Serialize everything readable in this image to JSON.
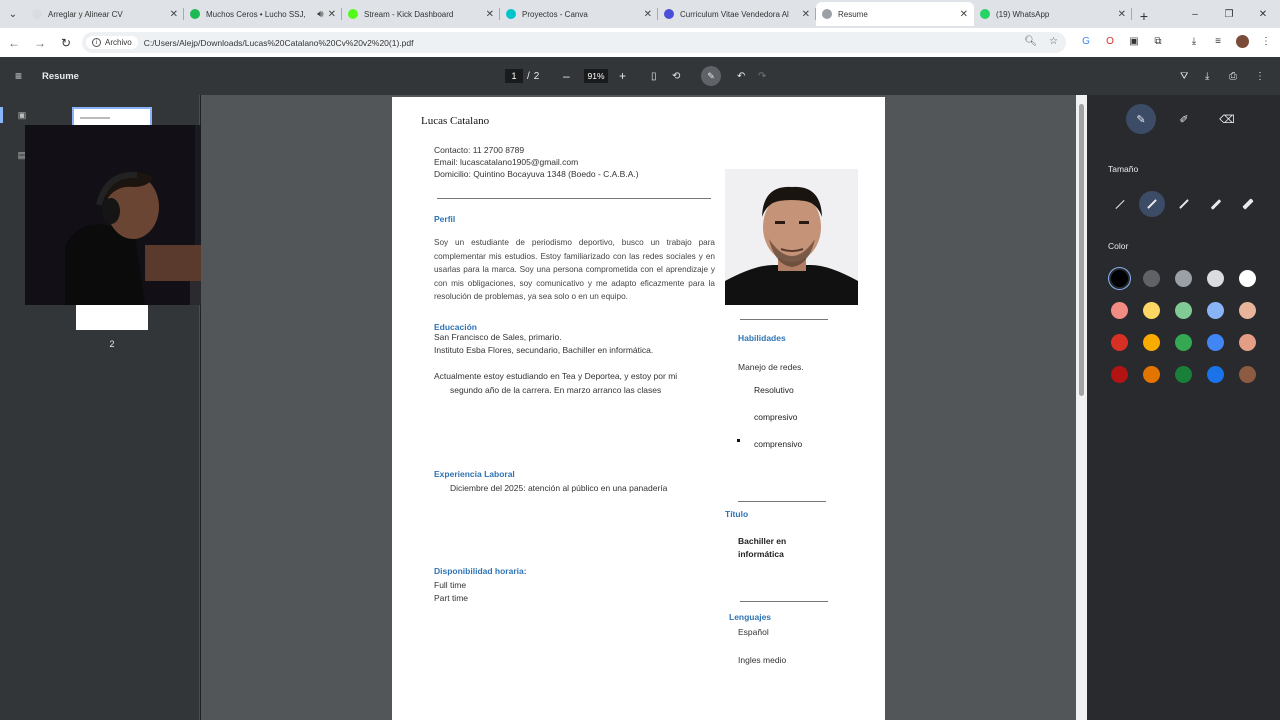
{
  "browser": {
    "tabs": [
      {
        "title": "Arreglar y Alinear CV",
        "active": false,
        "icon": "generic-site-icon",
        "color": "#dadce0"
      },
      {
        "title": "Muchos Ceros • Lucho SSJ,",
        "active": false,
        "icon": "spotify-icon",
        "color": "#1db954",
        "audio": true
      },
      {
        "title": "Stream - Kick Dashboard",
        "active": false,
        "icon": "kick-icon",
        "color": "#53fc18"
      },
      {
        "title": "Proyectos - Canva",
        "active": false,
        "icon": "canva-icon",
        "color": "#00c4cc"
      },
      {
        "title": "Curriculum Vitae Vendedora Al",
        "active": false,
        "icon": "canva-doc-icon",
        "color": "#4a4fd8"
      },
      {
        "title": "Resume",
        "active": true,
        "icon": "globe-icon",
        "color": "#9aa0a6"
      },
      {
        "title": "(19) WhatsApp",
        "active": false,
        "icon": "whatsapp-icon",
        "color": "#25d366"
      }
    ],
    "new_tab": "+",
    "window_controls": [
      "–",
      "❐",
      "✕"
    ],
    "address": {
      "chip": "Archivo",
      "url": "C:/Users/Alejp/Downloads/Lucas%20Catalano%20Cv%20v2%20(1).pdf"
    }
  },
  "viewer": {
    "title": "Resume",
    "current_page": "1",
    "page_sep": "/",
    "total_pages": "2",
    "zoom": "91%",
    "zoom_out": "–",
    "zoom_in": "+",
    "thumb_page_number": "2"
  },
  "resume": {
    "name": "Lucas Catalano",
    "contact": "Contacto: 11 2700 8789",
    "email": "Email:  lucascatalano1905@gmail.com",
    "address": "Domicilio: Quintino Bocayuva 1348 (Boedo - C.A.B.A.)",
    "perfil_heading": "Perfil",
    "perfil_text": "Soy un estudiante de periodismo deportivo, busco un trabajo para complementar mis estudios. Estoy familiarizado con las redes sociales y en usarlas para la marca. Soy una persona comprometida con el aprendizaje y con mis obligaciones, soy comunicativo y me adapto eficazmente para la resolución de problemas, ya sea solo o en un equipo.",
    "educacion_heading": "Educación",
    "educacion_1": "San Francisco de Sales, primario.",
    "educacion_2": "Instituto Esba Flores, secundario, Bachiller en informática.",
    "actual_1": "Actualmente estoy estudiando en Tea y Deportea, y estoy por mi",
    "actual_2": "segundo año de la carrera. En marzo arranco las clases",
    "experiencia_heading": "Experiencia Laboral",
    "experiencia_1": "Diciembre del 2025: atención al público en una panadería",
    "disponibilidad_heading": "Disponibilidad horaria:",
    "disp_1": "Full time",
    "disp_2": "Part time",
    "habilidades_heading": "Habilidades",
    "hab_1": "Manejo de redes.",
    "hab_2": "Resolutivo",
    "hab_3": "compresivo",
    "hab_4": "comprensivo",
    "titulo_heading": "Título",
    "titulo_1": "Bachiller en",
    "titulo_2": "informática",
    "lenguajes_heading": "Lenguajes",
    "leng_1": "Español",
    "leng_2": "Ingles medio"
  },
  "panel": {
    "size_label": "Tamaño",
    "color_label": "Color",
    "colors": [
      "#000000",
      "#5f6368",
      "#9aa0a6",
      "#dadce0",
      "#ffffff",
      "#f28b82",
      "#fdd663",
      "#81c995",
      "#8ab4f8",
      "#e8b59a",
      "#d93025",
      "#f9ab00",
      "#34a853",
      "#4285f4",
      "#e39e85",
      "#b31412",
      "#e37400",
      "#188038",
      "#1a73e8",
      "#8d5a42"
    ]
  }
}
